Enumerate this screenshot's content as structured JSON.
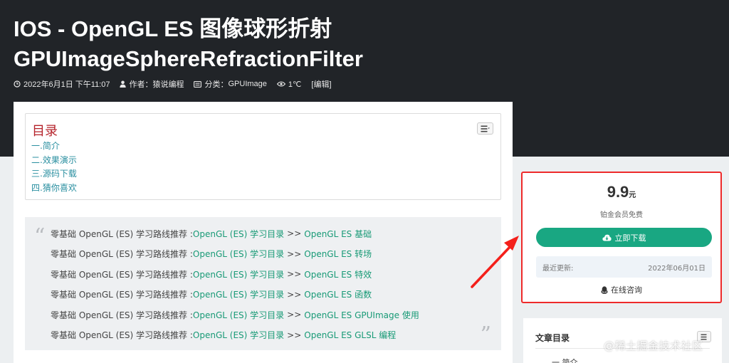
{
  "header": {
    "title_line1": "IOS - OpenGL ES 图像球形折射",
    "title_line2": "GPUImageSphereRefractionFilter",
    "date": "2022年6月1日 下午11:07",
    "author_label": "作者：",
    "author": "猿说编程",
    "category_label": "分类：",
    "category": "GPUImage",
    "views": "1℃",
    "edit": "[编辑]",
    "icons": [
      "clock-icon",
      "user-icon",
      "folder-icon",
      "eye-icon"
    ]
  },
  "toc": {
    "title": "目录",
    "items": [
      "一.简介",
      "二.效果演示",
      "三.源码下载",
      "四.猜你喜欢"
    ]
  },
  "quote": {
    "prefix": "零基础 OpenGL (ES) 学习路线推荐 : ",
    "link1": "OpenGL (ES) 学习目录",
    "separator": ">>",
    "lines": [
      "OpenGL ES 基础",
      "OpenGL ES 转场",
      "OpenGL ES 特效",
      "OpenGL ES 函数",
      "OpenGL ES GPUImage 使用",
      "OpenGL ES GLSL 编程"
    ]
  },
  "buy_box": {
    "price": "9.9",
    "price_unit": "元",
    "member_text": "铂金会员免费",
    "download_label": "立即下载",
    "update_label": "最近更新:",
    "update_date": "2022年06月01日",
    "consult_label": "在线咨询"
  },
  "sidebar_toc": {
    "title": "文章目录",
    "first_item": "一.简介"
  },
  "watermark": "@稀土掘金技术社区",
  "colors": {
    "header_bg": "#212428",
    "page_bg": "#eceff1",
    "toc_title": "#b5222a",
    "toc_link": "#2a8fa0",
    "quote_link": "#189a76",
    "button": "#19a782",
    "highlight": "#ee2a2a"
  }
}
